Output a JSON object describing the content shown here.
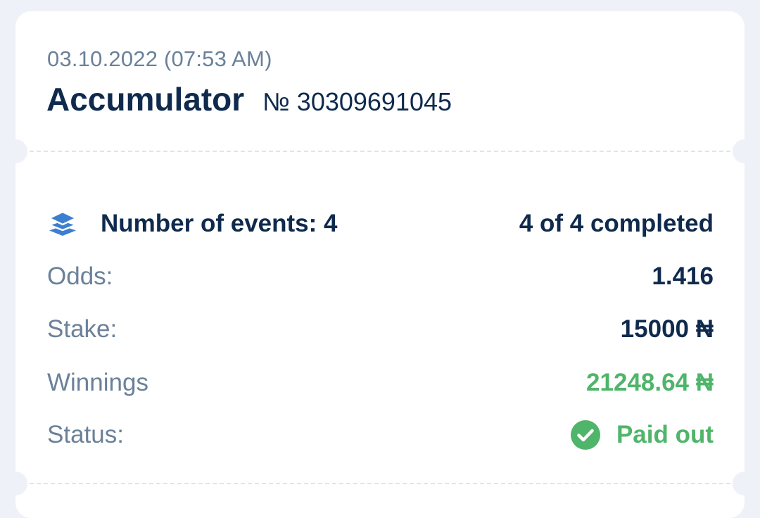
{
  "ticket": {
    "datetime": "03.10.2022 (07:53 AM)",
    "bet_type": "Accumulator",
    "bet_number": "№ 30309691045"
  },
  "details": {
    "events_label": "Number of events: 4",
    "events_completed": "4 of 4 completed",
    "odds_label": "Odds:",
    "odds_value": "1.416",
    "stake_label": "Stake:",
    "stake_value": "15000 ₦",
    "winnings_label": "Winnings",
    "winnings_value": "21248.64 ₦",
    "status_label": "Status:",
    "status_value": "Paid out"
  },
  "icons": {
    "events": "layers-icon",
    "status": "check-circle-icon"
  },
  "colors": {
    "accent_blue": "#3c7fd0",
    "success_green": "#4fb56a",
    "primary_text": "#0f2a4d",
    "secondary_text": "#6b8199"
  }
}
